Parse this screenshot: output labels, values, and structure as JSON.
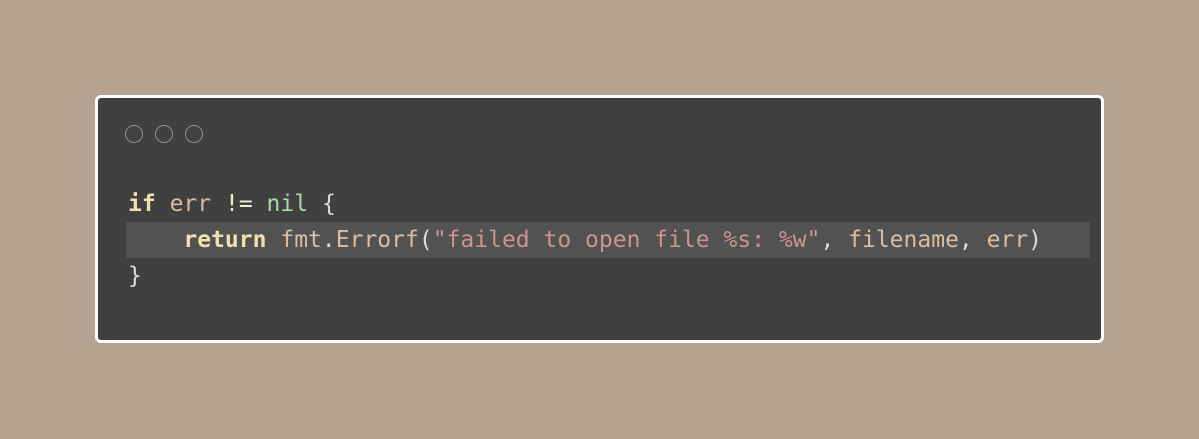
{
  "window": {
    "controls": [
      "close",
      "minimize",
      "maximize"
    ]
  },
  "code": {
    "language": "go",
    "lines": [
      {
        "tokens": {
          "t1": "if",
          "t2": " ",
          "t3": "err",
          "t4": " ",
          "t5": "!=",
          "t6": " ",
          "t7": "nil",
          "t8": " ",
          "t9": "{"
        }
      },
      {
        "highlighted": true,
        "tokens": {
          "indent": "    ",
          "t1": "return",
          "t2": " ",
          "t3": "fmt",
          "t4": ".",
          "t5": "Errorf",
          "t6": "(",
          "t7": "\"failed to open file %s: %w\"",
          "t8": ", ",
          "t9": "filename",
          "t10": ", ",
          "t11": "err",
          "t12": ")"
        }
      },
      {
        "tokens": {
          "t1": "}"
        }
      }
    ]
  },
  "colors": {
    "background": "#b5a290",
    "editor": "#404040",
    "highlight_line": "#525252",
    "keyword": "#f0dfaf",
    "string": "#cc9393",
    "nil": "#a8d8a8"
  }
}
